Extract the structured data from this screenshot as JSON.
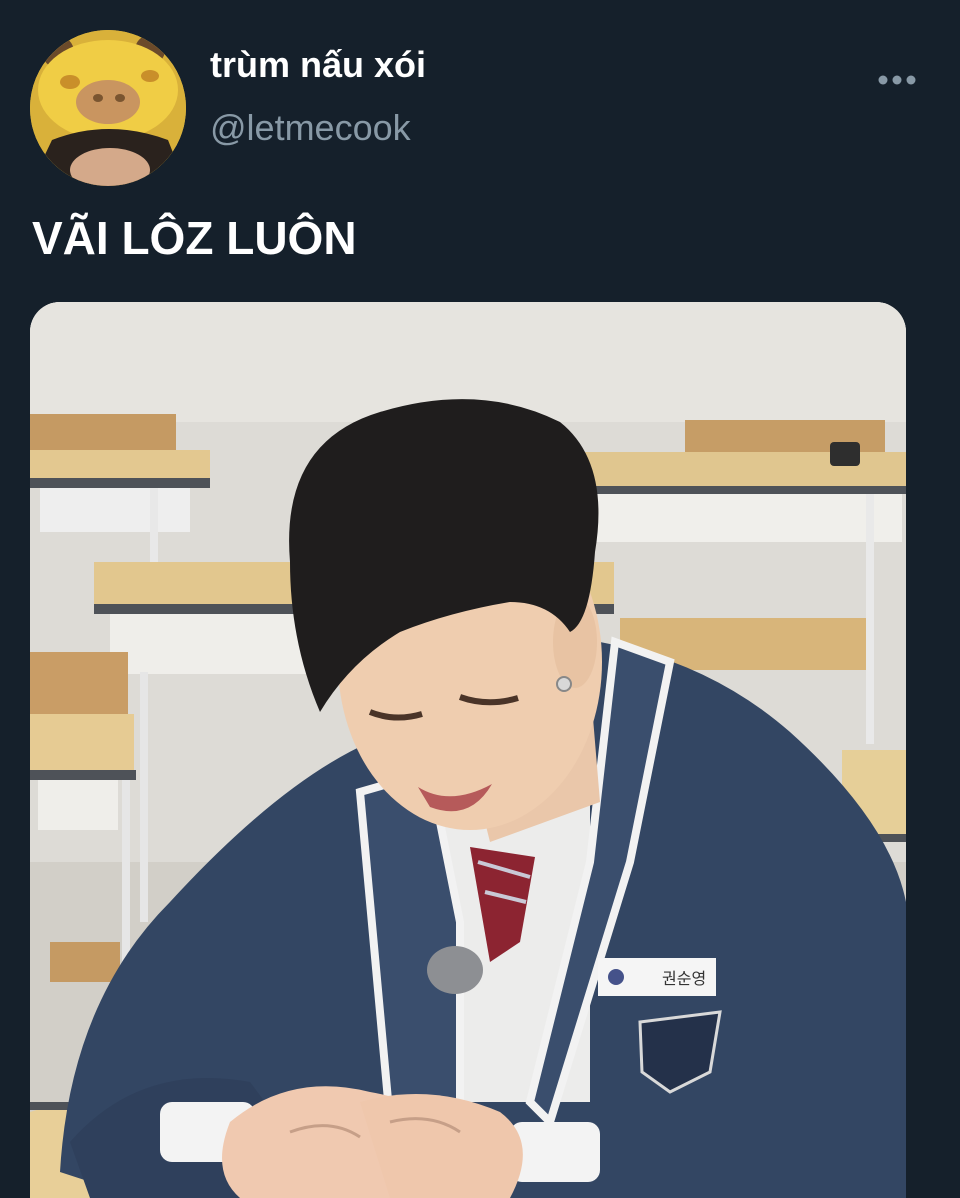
{
  "tweet": {
    "author": {
      "display_name": "trùm nấu xói",
      "handle": "@letmecook",
      "avatar_icon": "giraffe-hat-avatar"
    },
    "more_icon": "more-horizontal-icon",
    "text": "VÃI LÔZ LUÔN",
    "media": {
      "kind": "photo",
      "name_tag_text": "권순영"
    }
  },
  "colors": {
    "background": "#15202b",
    "text_primary": "#ffffff",
    "text_secondary": "#8899a6"
  }
}
